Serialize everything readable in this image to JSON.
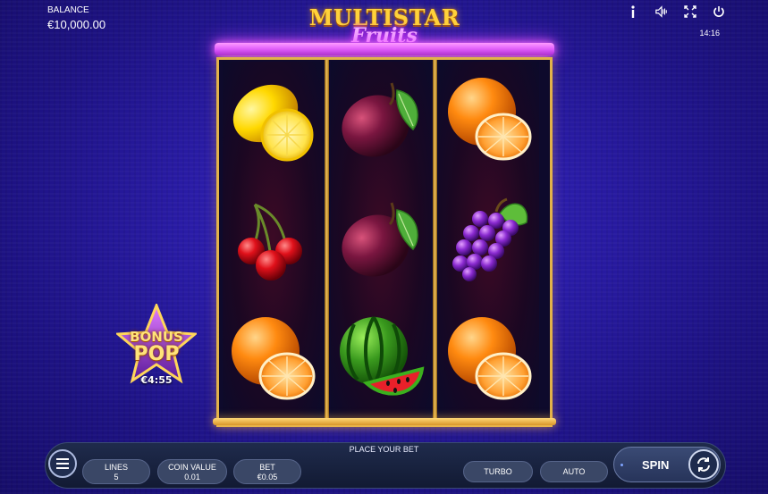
{
  "header": {
    "balance_label": "BALANCE",
    "balance_value": "€10,000.00",
    "clock": "14:16"
  },
  "icons": [
    "info-icon",
    "sound-icon",
    "fullscreen-icon",
    "power-icon"
  ],
  "logo": {
    "main": "MULTISTAR",
    "sub": "Fruits"
  },
  "reels": [
    [
      "lemon",
      "cherries",
      "orange"
    ],
    [
      "plum",
      "plum",
      "watermelon"
    ],
    [
      "orange",
      "grapes",
      "orange"
    ]
  ],
  "bonus": {
    "line1": "BONUS",
    "line2": "POP",
    "timer": "€4:55"
  },
  "controls": {
    "status": "PLACE YOUR BET",
    "lines_label": "LINES",
    "lines_value": "5",
    "coin_label": "COIN VALUE",
    "coin_value": "0.01",
    "bet_label": "BET",
    "bet_value": "€0.05",
    "turbo_label": "TURBO",
    "auto_label": "AUTO",
    "spin_label": "SPIN"
  },
  "colors": {
    "background": "#2a1ca8",
    "frame_gold": "#e2b24a",
    "neon_pink": "#e05cff"
  }
}
